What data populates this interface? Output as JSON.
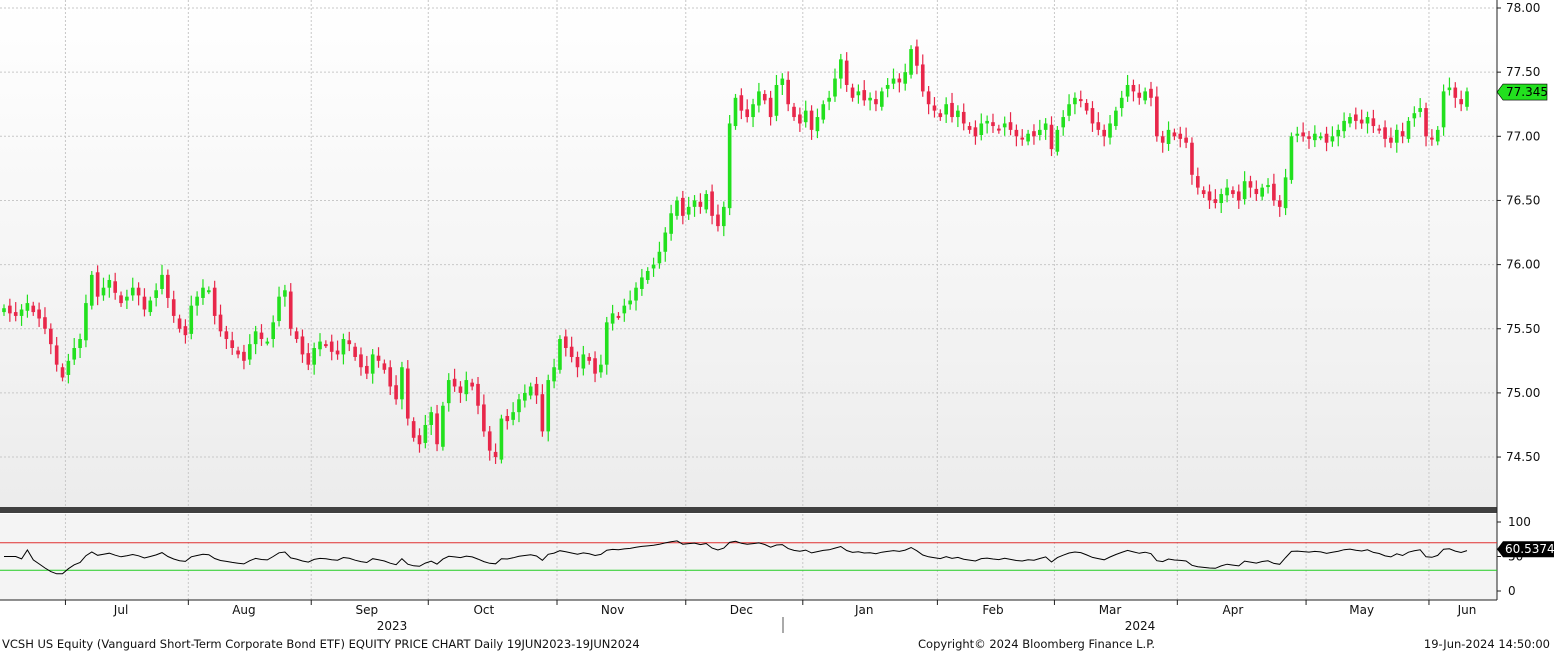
{
  "footer": {
    "left": "VCSH US Equity (Vanguard Short-Term Corporate Bond ETF) EQUITY PRICE CHART  Daily 19JUN2023-19JUN2024",
    "center": "Copyright© 2024 Bloomberg Finance L.P.",
    "right": "19-Jun-2024 14:50:00"
  },
  "colors": {
    "up": "#22e01e",
    "down": "#e8274a",
    "grid": "#c8c8c8",
    "rsi_line": "#000000",
    "rsi_upper": "#e03030",
    "rsi_lower": "#22cc22",
    "badge": "#22e01e",
    "separator": "#404040"
  },
  "chart_data": {
    "type": "candlestick",
    "title": "",
    "price_axis": {
      "ticks": [
        "74.50",
        "75.00",
        "75.50",
        "76.00",
        "76.50",
        "77.00",
        "77.50",
        "78.00"
      ],
      "range": [
        74.1,
        78.0
      ]
    },
    "rsi_axis": {
      "ticks": [
        "0",
        "50",
        "100"
      ],
      "range": [
        -10,
        110
      ],
      "upper_level": 70,
      "lower_level": 30
    },
    "time_axis": {
      "months": [
        "Jul",
        "Aug",
        "Sep",
        "Oct",
        "Nov",
        "Dec",
        "Jan",
        "Feb",
        "Mar",
        "Apr",
        "May",
        "Jun"
      ],
      "years": [
        "2023",
        "2024"
      ]
    },
    "last_price": "77.345",
    "last_rsi": "60.5374",
    "grid": true,
    "closes": [
      75.66,
      75.62,
      75.6,
      75.65,
      75.7,
      75.63,
      75.58,
      75.5,
      75.38,
      75.22,
      75.12,
      75.25,
      75.35,
      75.42,
      75.7,
      75.92,
      75.75,
      75.82,
      75.88,
      75.78,
      75.7,
      75.75,
      75.82,
      75.76,
      75.65,
      75.72,
      75.8,
      75.92,
      75.74,
      75.6,
      75.5,
      75.45,
      75.68,
      75.75,
      75.82,
      75.8,
      75.6,
      75.48,
      75.42,
      75.35,
      75.3,
      75.25,
      75.38,
      75.48,
      75.42,
      75.4,
      75.55,
      75.75,
      75.8,
      75.5,
      75.42,
      75.3,
      75.22,
      75.35,
      75.4,
      75.38,
      75.32,
      75.3,
      75.42,
      75.38,
      75.28,
      75.2,
      75.15,
      75.3,
      75.25,
      75.18,
      75.05,
      74.95,
      75.2,
      74.8,
      74.65,
      74.6,
      74.75,
      74.85,
      74.6,
      74.9,
      75.1,
      75.05,
      75.0,
      75.1,
      75.05,
      74.9,
      74.7,
      74.55,
      74.5,
      74.8,
      74.78,
      74.85,
      74.95,
      75.0,
      75.05,
      74.98,
      74.7,
      75.1,
      75.2,
      75.42,
      75.35,
      75.28,
      75.2,
      75.3,
      75.25,
      75.15,
      75.22,
      75.55,
      75.62,
      75.6,
      75.68,
      75.72,
      75.82,
      75.9,
      75.95,
      76.0,
      76.1,
      76.25,
      76.4,
      76.5,
      76.38,
      76.45,
      76.5,
      76.45,
      76.55,
      76.38,
      76.3,
      76.45,
      77.1,
      77.3,
      77.2,
      77.15,
      77.25,
      77.35,
      77.28,
      77.15,
      77.4,
      77.45,
      77.25,
      77.15,
      77.1,
      77.2,
      77.05,
      77.15,
      77.25,
      77.3,
      77.45,
      77.6,
      77.4,
      77.3,
      77.35,
      77.28,
      77.3,
      77.25,
      77.35,
      77.4,
      77.45,
      77.42,
      77.5,
      77.68,
      77.55,
      77.35,
      77.25,
      77.2,
      77.15,
      77.25,
      77.15,
      77.2,
      77.1,
      77.05,
      77.0,
      77.1,
      77.12,
      77.08,
      77.05,
      77.1,
      77.05,
      77.0,
      76.98,
      77.02,
      77.0,
      77.05,
      77.1,
      76.9,
      77.05,
      77.15,
      77.25,
      77.3,
      77.28,
      77.2,
      77.1,
      77.05,
      77.0,
      77.1,
      77.2,
      77.3,
      77.4,
      77.35,
      77.3,
      77.35,
      77.3,
      77.0,
      76.95,
      77.05,
      77.0,
      76.98,
      76.95,
      76.7,
      76.6,
      76.55,
      76.5,
      76.48,
      76.55,
      76.6,
      76.55,
      76.5,
      76.65,
      76.6,
      76.55,
      76.6,
      76.62,
      76.5,
      76.45,
      76.68,
      77.0,
      77.02,
      77.0,
      76.98,
      77.02,
      77.0,
      76.95,
      77.0,
      77.05,
      77.12,
      77.15,
      77.12,
      77.1,
      77.15,
      77.08,
      77.05,
      76.98,
      76.95,
      77.05,
      77.0,
      77.12,
      77.18,
      77.22,
      77.0,
      76.98,
      77.05,
      77.35,
      77.38,
      77.3,
      77.25,
      77.35
    ]
  }
}
